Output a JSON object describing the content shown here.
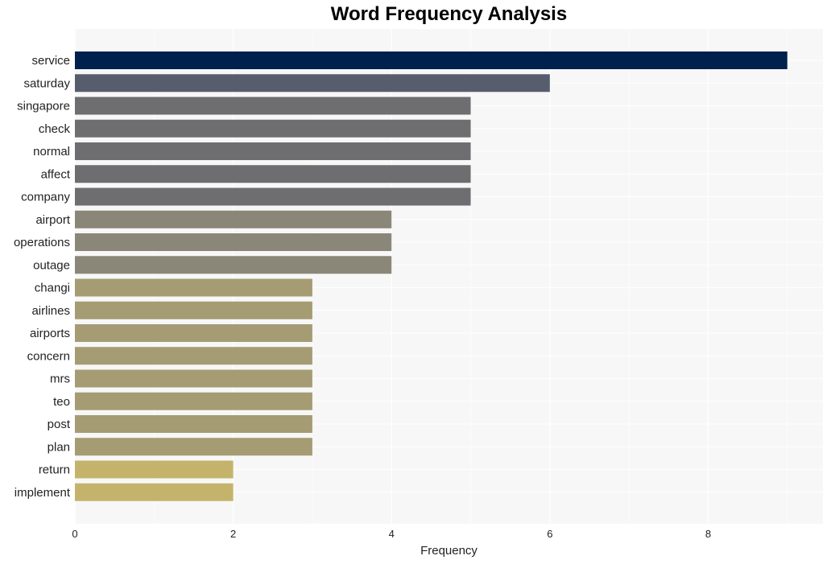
{
  "chart_data": {
    "type": "bar",
    "orientation": "horizontal",
    "title": "Word Frequency Analysis",
    "xlabel": "Frequency",
    "ylabel": "",
    "xlim": [
      0,
      9.45
    ],
    "xticks": [
      0,
      2,
      4,
      6,
      8
    ],
    "grid": true,
    "legend": "none",
    "categories": [
      "service",
      "saturday",
      "singapore",
      "check",
      "normal",
      "affect",
      "company",
      "airport",
      "operations",
      "outage",
      "changi",
      "airlines",
      "airports",
      "concern",
      "mrs",
      "teo",
      "post",
      "plan",
      "return",
      "implement"
    ],
    "values": [
      9,
      6,
      5,
      5,
      5,
      5,
      5,
      4,
      4,
      4,
      3,
      3,
      3,
      3,
      3,
      3,
      3,
      3,
      2,
      2
    ],
    "colors": {
      "9": "#00204e",
      "6": "#575d6d",
      "5": "#6e6e70",
      "4": "#8a8779",
      "3": "#a59c74",
      "2": "#c4b36a"
    },
    "plot_background": "#f7f7f7",
    "grid_color": "#ffffff"
  }
}
